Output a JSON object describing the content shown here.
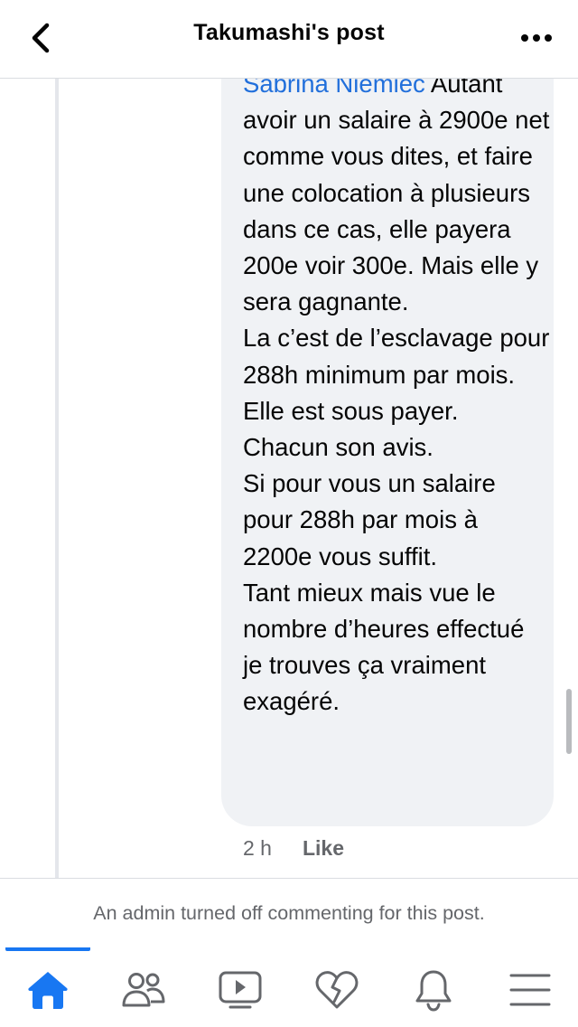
{
  "header": {
    "title": "Takumashi's post",
    "back_icon": "chevron-left-icon",
    "more_icon": "more-horizontal-icon"
  },
  "comment": {
    "mention": "Sabrina Niemiec",
    "text": " Autant avoir un salaire à 2900e net comme vous dites, et faire une colocation à plusieurs dans ce cas, elle payera 200e voir 300e. Mais elle y sera gagnante.\nLa c’est de l’esclavage pour 288h minimum par mois.\nElle est sous payer.\nChacun son avis.\nSi pour vous un salaire pour 288h par mois à 2200e vous suffit.\nTant mieux mais vue le nombre d’heures effectué je trouves ça vraiment exagéré.",
    "time": "2 h",
    "like_label": "Like"
  },
  "notice": {
    "text": "An admin turned off commenting for this post."
  },
  "tabbar": {
    "items": [
      {
        "icon": "home-icon",
        "active": true
      },
      {
        "icon": "friends-icon",
        "active": false
      },
      {
        "icon": "video-icon",
        "active": false
      },
      {
        "icon": "dating-heart-icon",
        "active": false
      },
      {
        "icon": "notifications-bell-icon",
        "active": false
      },
      {
        "icon": "menu-icon",
        "active": false
      }
    ]
  },
  "colors": {
    "accent": "#1877f2",
    "mention": "#216fdb",
    "bubble": "#f0f2f5",
    "secondary_text": "#65676b"
  }
}
